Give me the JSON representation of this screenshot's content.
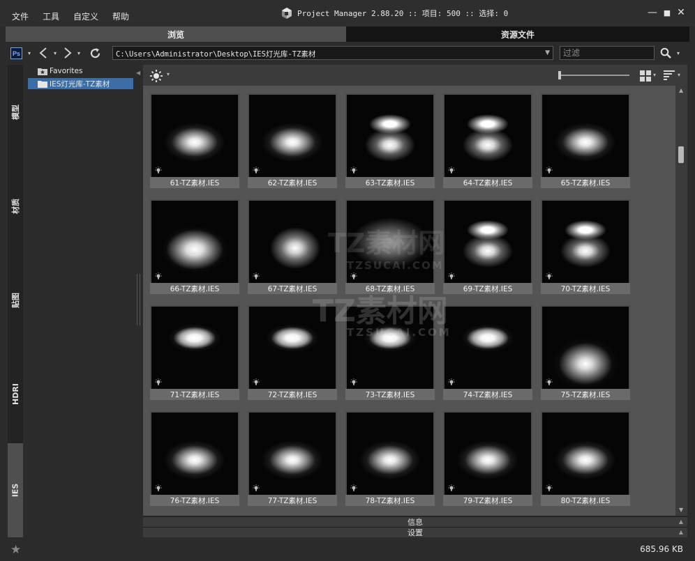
{
  "menu": [
    "文件",
    "工具",
    "自定义",
    "帮助"
  ],
  "app_title": "Project Manager 2.88.20  :: 项目: 500  :: 选择: 0",
  "window_controls": {
    "minimize": "—",
    "maximize": "■",
    "close": "✕"
  },
  "tabs": [
    {
      "label": "浏览",
      "active": true
    },
    {
      "label": "资源文件",
      "active": false
    }
  ],
  "toolbar": {
    "ps_label": "Ps",
    "path": "C:\\Users\\Administrator\\Desktop\\IES灯光库-TZ素材",
    "filter_placeholder": "过滤"
  },
  "vertical_tabs": [
    {
      "label": "模型",
      "active": false
    },
    {
      "label": "材质",
      "active": false
    },
    {
      "label": "贴图",
      "active": false
    },
    {
      "label": "HDRI",
      "active": false
    },
    {
      "label": "IES",
      "active": true
    }
  ],
  "tree": [
    {
      "label": "Favorites",
      "icon": "star-folder-icon",
      "selected": false
    },
    {
      "label": "IES灯光库-TZ素材",
      "icon": "folder-icon",
      "selected": true
    }
  ],
  "items": [
    {
      "name": "61-TZ素材.IES",
      "style": "low"
    },
    {
      "name": "62-TZ素材.IES",
      "style": "low"
    },
    {
      "name": "63-TZ素材.IES",
      "style": "double"
    },
    {
      "name": "64-TZ素材.IES",
      "style": "double"
    },
    {
      "name": "65-TZ素材.IES",
      "style": "low"
    },
    {
      "name": "66-TZ素材.IES",
      "style": "wide"
    },
    {
      "name": "67-TZ素材.IES",
      "style": "peak"
    },
    {
      "name": "68-TZ素材.IES",
      "style": "bowl"
    },
    {
      "name": "69-TZ素材.IES",
      "style": "double"
    },
    {
      "name": "70-TZ素材.IES",
      "style": "double"
    },
    {
      "name": "71-TZ素材.IES",
      "style": "high"
    },
    {
      "name": "72-TZ素材.IES",
      "style": "high"
    },
    {
      "name": "73-TZ素材.IES",
      "style": "high"
    },
    {
      "name": "74-TZ素材.IES",
      "style": "high"
    },
    {
      "name": "75-TZ素材.IES",
      "style": "cone"
    },
    {
      "name": "76-TZ素材.IES",
      "style": "low"
    },
    {
      "name": "77-TZ素材.IES",
      "style": "low"
    },
    {
      "name": "78-TZ素材.IES",
      "style": "low"
    },
    {
      "name": "79-TZ素材.IES",
      "style": "low"
    },
    {
      "name": "80-TZ素材.IES",
      "style": "low"
    }
  ],
  "bottom_panels": [
    "信息",
    "设置"
  ],
  "status": {
    "file_size": "685.96 KB"
  },
  "watermark": {
    "text": "TZ素材网",
    "url": "TZSUCAI.COM"
  },
  "colors": {
    "selected": "#3c6ea5",
    "accent_ps": "#5fa7ff"
  }
}
